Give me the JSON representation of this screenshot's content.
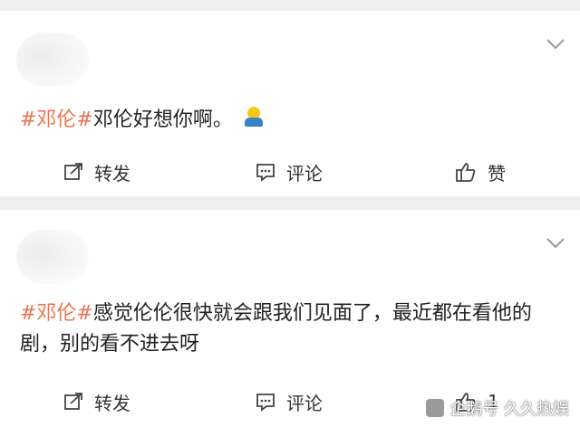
{
  "posts": [
    {
      "tag": "#邓伦#",
      "text": "邓伦好想你啊。",
      "emoji": "person-emoji",
      "actions": {
        "repost": "转发",
        "comment": "评论",
        "like": "赞"
      }
    },
    {
      "tag": "#邓伦#",
      "text": "感觉伦伦很快就会跟我们见面了，最近都在看他的剧，别的看不进去呀",
      "actions": {
        "repost": "转发",
        "comment": "评论",
        "like": "1"
      }
    }
  ],
  "watermark": {
    "text": "企鹅号 久久热娱"
  },
  "colors": {
    "tag": "#eb7350",
    "background": "#efefef",
    "card": "#ffffff",
    "text": "#222222"
  }
}
